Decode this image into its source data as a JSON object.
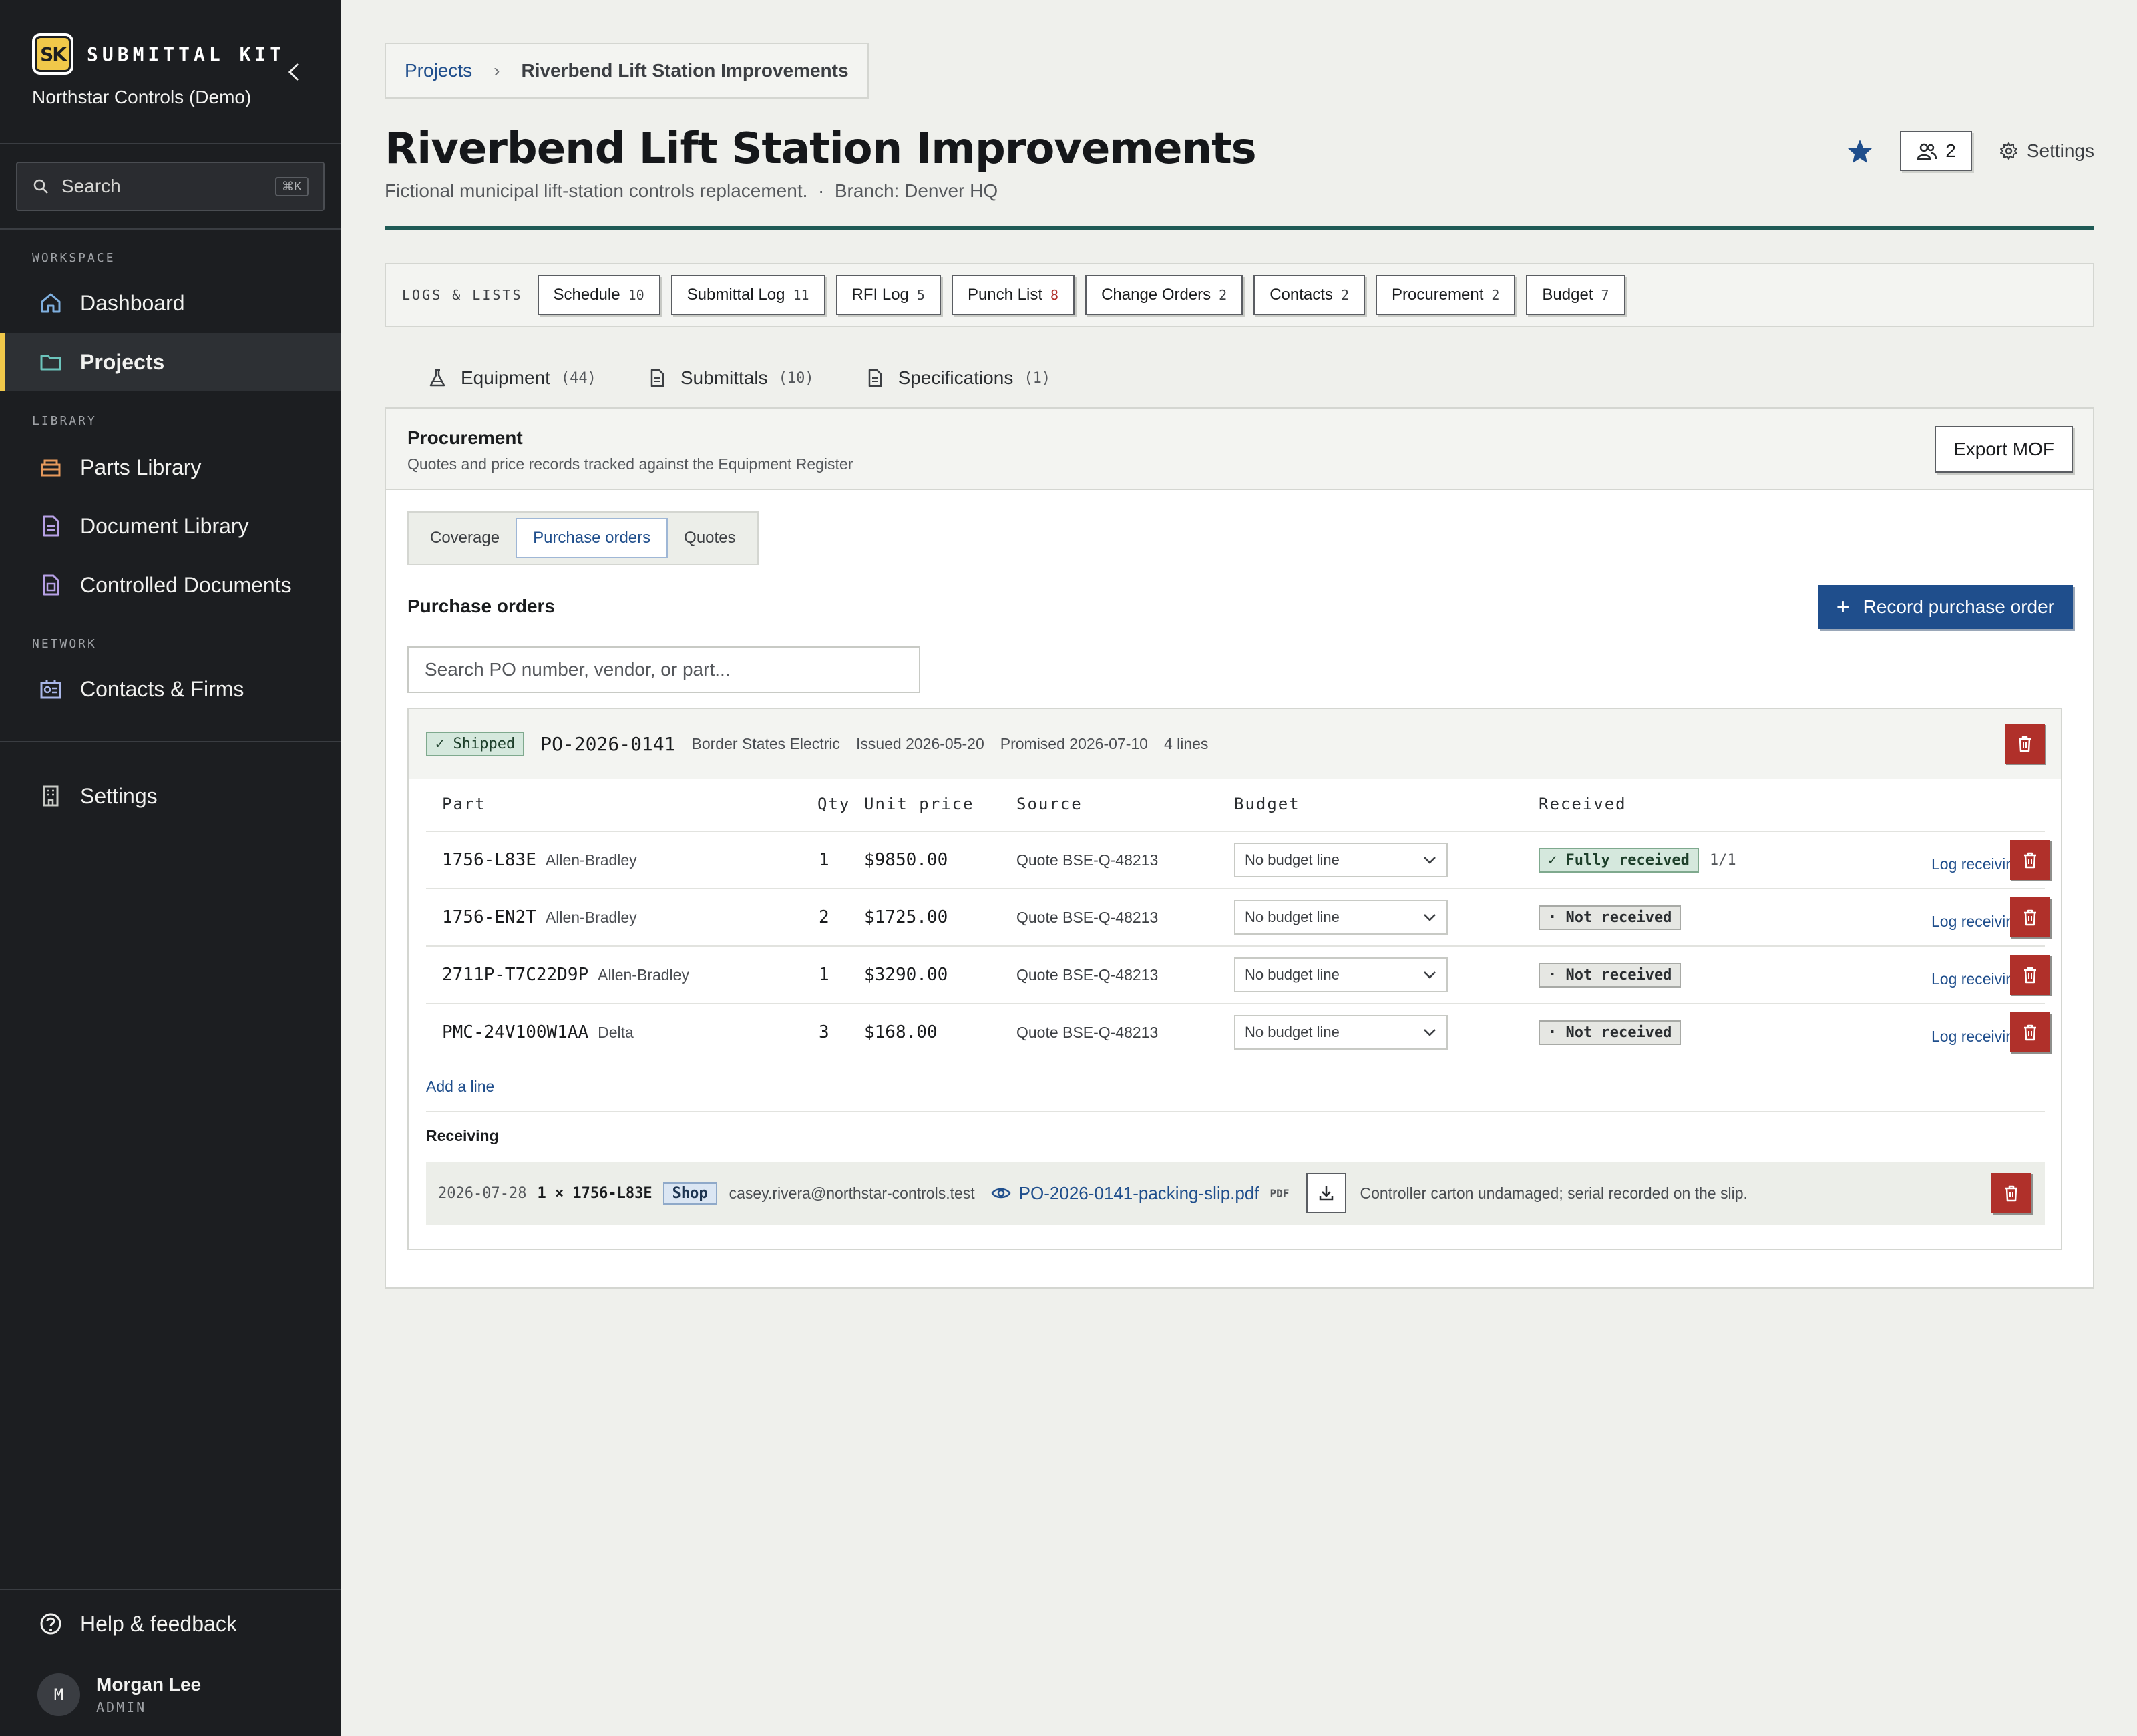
{
  "sidebar": {
    "brand_mark": "SK",
    "brand_name": "SUBMITTAL KIT",
    "org": "Northstar Controls (Demo)",
    "search_placeholder": "Search",
    "search_shortcut": "⌘K",
    "section_workspace": "WORKSPACE",
    "section_library": "LIBRARY",
    "section_network": "NETWORK",
    "items": {
      "dashboard": "Dashboard",
      "projects": "Projects",
      "parts_library": "Parts Library",
      "document_library": "Document Library",
      "controlled_documents": "Controlled Documents",
      "contacts_firms": "Contacts & Firms",
      "settings": "Settings",
      "help": "Help & feedback"
    },
    "active_item": "projects",
    "user": {
      "initial": "M",
      "name": "Morgan Lee",
      "role": "ADMIN"
    }
  },
  "breadcrumb": {
    "parent": "Projects",
    "current": "Riverbend Lift Station Improvements"
  },
  "header": {
    "title": "Riverbend Lift Station Improvements",
    "description": "Fictional municipal lift-station controls replacement.",
    "branch": "Branch: Denver HQ",
    "members_count": "2",
    "settings_label": "Settings",
    "starred": true
  },
  "logs": {
    "label": "LOGS & LISTS",
    "chips": [
      {
        "label": "Schedule",
        "count": "10"
      },
      {
        "label": "Submittal Log",
        "count": "11"
      },
      {
        "label": "RFI Log",
        "count": "5"
      },
      {
        "label": "Punch List",
        "count": "8",
        "alert": true
      },
      {
        "label": "Change Orders",
        "count": "2"
      },
      {
        "label": "Contacts",
        "count": "2"
      },
      {
        "label": "Procurement",
        "count": "2"
      },
      {
        "label": "Budget",
        "count": "7"
      }
    ]
  },
  "tabs": [
    {
      "label": "Equipment",
      "count": "(44)"
    },
    {
      "label": "Submittals",
      "count": "(10)"
    },
    {
      "label": "Specifications",
      "count": "(1)"
    }
  ],
  "procurement": {
    "title": "Procurement",
    "subtitle": "Quotes and price records tracked against the Equipment Register",
    "export_label": "Export MOF",
    "segments": [
      "Coverage",
      "Purchase orders",
      "Quotes"
    ],
    "active_segment": "Purchase orders",
    "section_title": "Purchase orders",
    "record_label": "Record purchase order",
    "search_placeholder": "Search PO number, vendor, or part...",
    "columns": {
      "part": "Part",
      "qty": "Qty",
      "unit_price": "Unit price",
      "source": "Source",
      "budget": "Budget",
      "received": "Received"
    },
    "po": {
      "status": "✓ Shipped",
      "number": "PO-2026-0141",
      "vendor": "Border States Electric",
      "issued": "Issued 2026-05-20",
      "promised": "Promised 2026-07-10",
      "lines_count": "4 lines",
      "lines": [
        {
          "part": "1756-L83E",
          "mfr": "Allen-Bradley",
          "qty": "1",
          "price": "$9850.00",
          "source": "Quote BSE-Q-48213",
          "budget": "No budget line",
          "received": "✓ Fully received",
          "fraction": "1/1",
          "full": true,
          "action": "Log receiving"
        },
        {
          "part": "1756-EN2T",
          "mfr": "Allen-Bradley",
          "qty": "2",
          "price": "$1725.00",
          "source": "Quote BSE-Q-48213",
          "budget": "No budget line",
          "received": "· Not received",
          "fraction": "",
          "full": false,
          "action": "Log receiving"
        },
        {
          "part": "2711P-T7C22D9P",
          "mfr": "Allen-Bradley",
          "qty": "1",
          "price": "$3290.00",
          "source": "Quote BSE-Q-48213",
          "budget": "No budget line",
          "received": "· Not received",
          "fraction": "",
          "full": false,
          "action": "Log receiving"
        },
        {
          "part": "PMC-24V100W1AA",
          "mfr": "Delta",
          "qty": "3",
          "price": "$168.00",
          "source": "Quote BSE-Q-48213",
          "budget": "No budget line",
          "received": "· Not received",
          "fraction": "",
          "full": false,
          "action": "Log receiving"
        }
      ],
      "add_line": "Add a line",
      "receiving": {
        "title": "Receiving",
        "entry": {
          "date": "2026-07-28",
          "item": "1 × 1756-L83E",
          "location": "Shop",
          "user": "casey.rivera@northstar-controls.test",
          "file": "PO-2026-0141-packing-slip.pdf",
          "file_type": "PDF",
          "note": "Controller carton undamaged; serial recorded on the slip."
        }
      }
    }
  },
  "colors": {
    "sidebar_bg": "#1c1e21",
    "accent_yellow": "#f0c84a",
    "primary_blue": "#1f4e8c",
    "danger_red": "#b0302a",
    "rule_teal": "#1f5a55"
  }
}
